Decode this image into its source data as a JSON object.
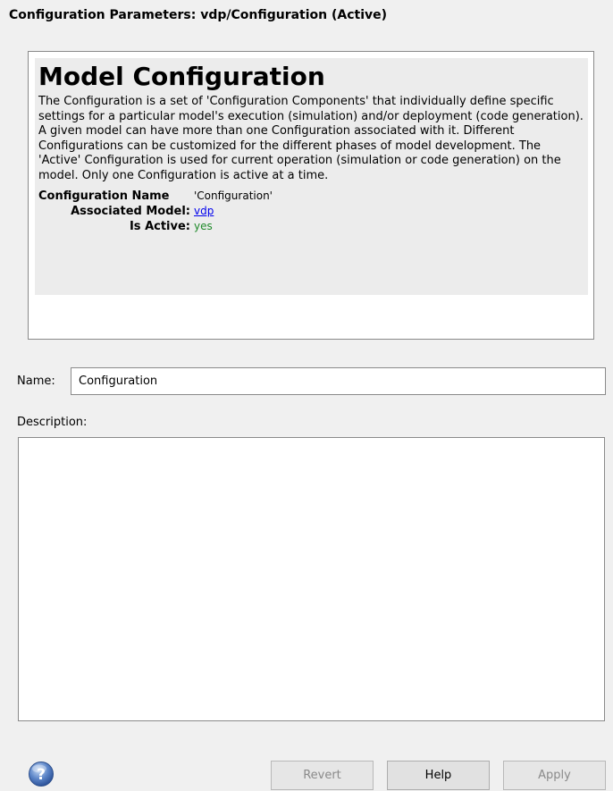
{
  "window": {
    "title": "Configuration Parameters: vdp/Configuration (Active)"
  },
  "info_panel": {
    "heading": "Model Configuration",
    "description": "The Configuration is a set of 'Configuration Components' that individually define specific settings for a particular model's execution (simulation) and/or deployment (code generation). A given model can have more than one Configuration associated with it. Different Configurations can be customized for the different phases of model development. The 'Active' Configuration is used for current operation (simulation or code generation) on the model. Only one Configuration is active at a time.",
    "fields": {
      "configuration_name_label": "Configuration Name",
      "configuration_name_value": "'Configuration'",
      "associated_model_label": "Associated Model:",
      "associated_model_value": "vdp",
      "is_active_label": "Is Active:",
      "is_active_value": "yes"
    }
  },
  "form": {
    "name_label": "Name:",
    "name_value": "Configuration",
    "description_label": "Description:",
    "description_value": ""
  },
  "buttons": {
    "revert": "Revert",
    "help": "Help",
    "apply": "Apply"
  },
  "icons": {
    "help": "help-icon"
  },
  "colors": {
    "link": "#0000ee",
    "active_value": "#1f8a2a",
    "disabled_text": "#8a8a8a"
  }
}
